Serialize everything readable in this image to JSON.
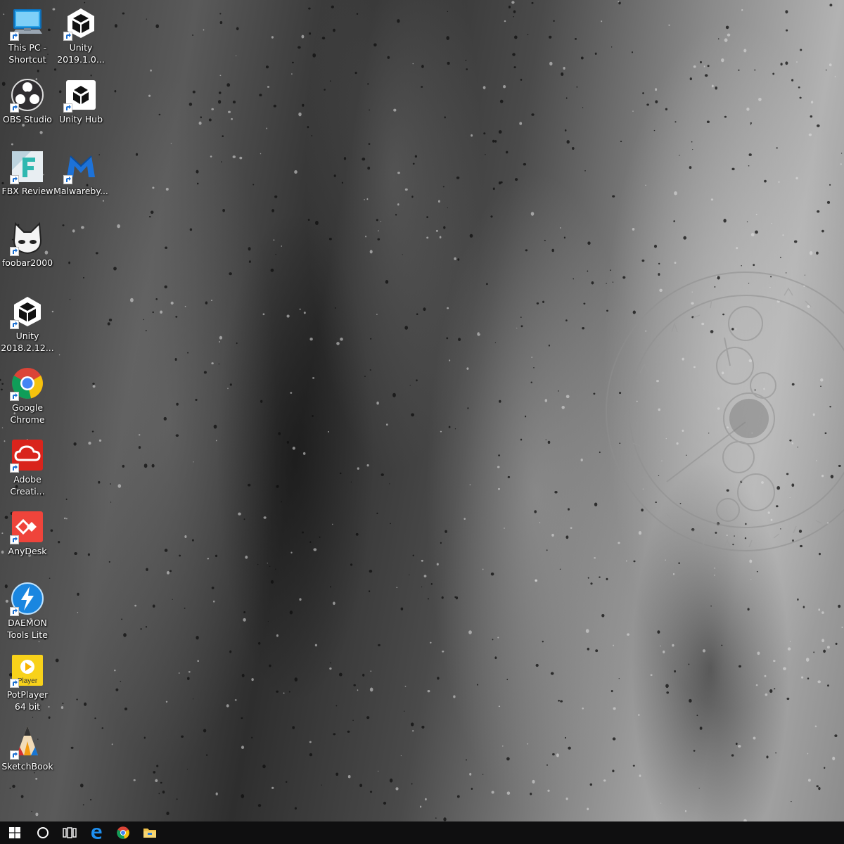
{
  "desktop": {
    "icons": [
      {
        "label": "This PC - Shortcut",
        "icon": "this-pc-icon"
      },
      {
        "label": "Unity 2019.1.0...",
        "icon": "unity-icon"
      },
      {
        "label": "OBS Studio",
        "icon": "obs-studio-icon"
      },
      {
        "label": "Unity Hub",
        "icon": "unity-hub-icon"
      },
      {
        "label": "FBX Review",
        "icon": "fbx-review-icon"
      },
      {
        "label": "Malwareby...",
        "icon": "malwarebytes-icon"
      },
      {
        "label": "foobar2000",
        "icon": "foobar2000-icon"
      },
      {
        "label": "Unity 2018.2.12...",
        "icon": "unity-icon"
      },
      {
        "label": "Google Chrome",
        "icon": "google-chrome-icon"
      },
      {
        "label": "Adobe Creati...",
        "icon": "adobe-creative-cloud-icon"
      },
      {
        "label": "AnyDesk",
        "icon": "anydesk-icon"
      },
      {
        "label": "DAEMON Tools Lite",
        "icon": "daemon-tools-icon"
      },
      {
        "label": "PotPlayer 64 bit",
        "icon": "potplayer-icon"
      },
      {
        "label": "SketchBook",
        "icon": "sketchbook-icon"
      }
    ],
    "potplayer_badge_text": "Player"
  },
  "taskbar": {
    "buttons": [
      {
        "name": "start-button",
        "icon": "windows-logo-icon"
      },
      {
        "name": "cortana-button",
        "icon": "search-circle-icon"
      },
      {
        "name": "task-view-button",
        "icon": "task-view-icon"
      },
      {
        "name": "edge-button",
        "icon": "edge-icon"
      },
      {
        "name": "chrome-button",
        "icon": "chrome-icon"
      },
      {
        "name": "file-explorer-button",
        "icon": "folder-icon"
      }
    ],
    "colors": {
      "background": "#0f0f10",
      "accent": "#1e8ff0"
    }
  }
}
